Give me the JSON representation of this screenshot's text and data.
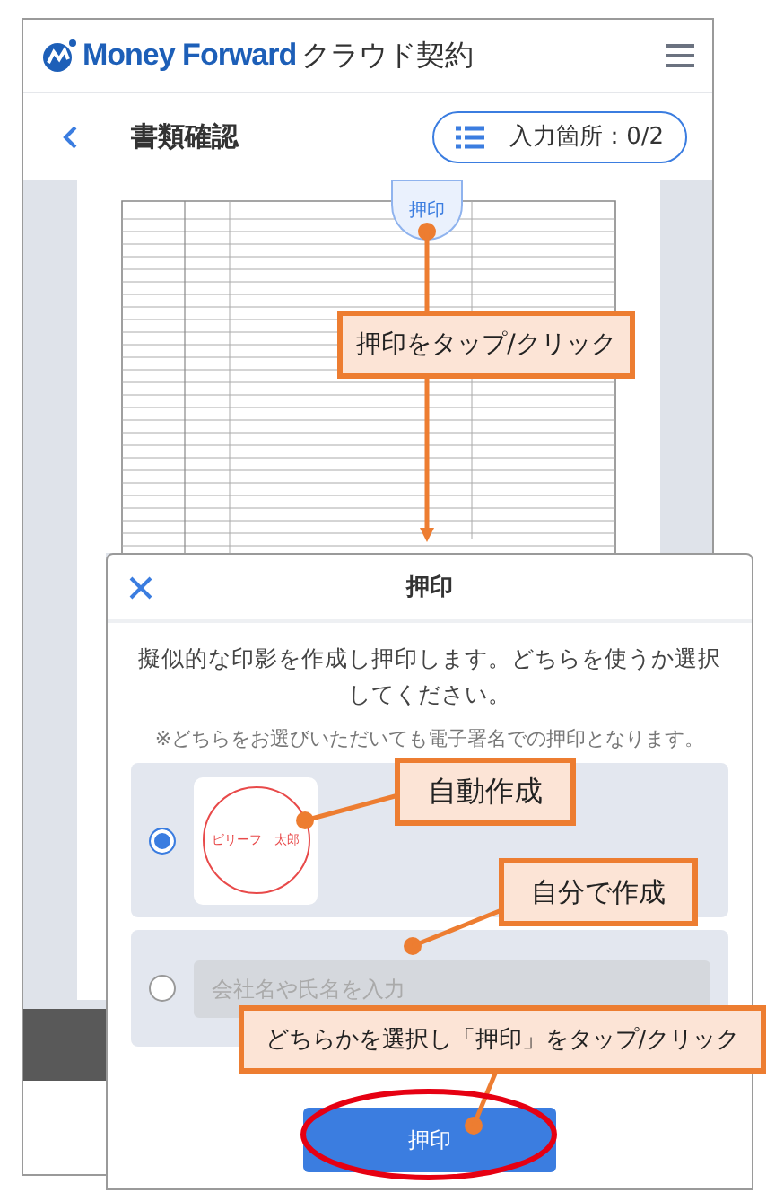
{
  "header": {
    "brand": "Money Forward",
    "product": "クラウド契約"
  },
  "subheader": {
    "title": "書類確認",
    "input_counter": "入力箇所：0/2"
  },
  "document": {
    "stamp_button": "押印"
  },
  "modal": {
    "title": "押印",
    "description": "擬似的な印影を作成し押印します。どちらを使うか選択してください。",
    "note": "※どちらをお選びいただいても電子署名での押印となります。",
    "options": [
      {
        "kind": "auto",
        "selected": true,
        "seal_text": "ビリーフ　太郎"
      },
      {
        "kind": "manual",
        "selected": false,
        "placeholder": "会社名や氏名を入力"
      }
    ],
    "submit": "押印"
  },
  "annotations": [
    {
      "text": "押印をタップ/クリック"
    },
    {
      "text": "自動作成"
    },
    {
      "text": "自分で作成"
    },
    {
      "text": "どちらかを選択し「押印」をタップ/クリック"
    }
  ]
}
